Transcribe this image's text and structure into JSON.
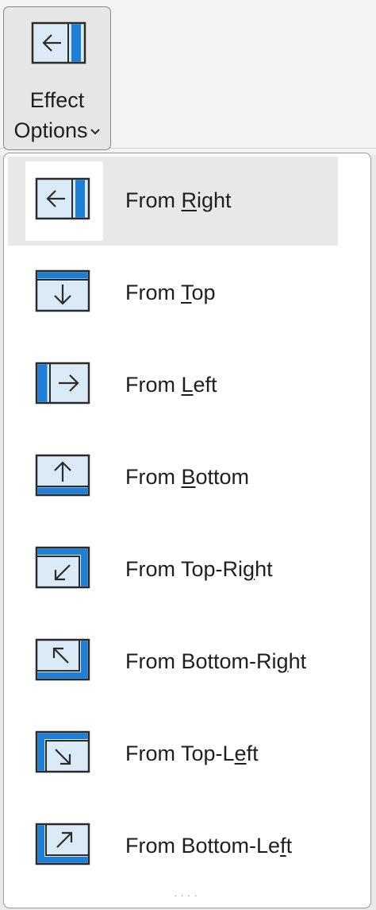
{
  "button": {
    "line1": "Effect",
    "line2": "Options",
    "icon": "from-right-icon"
  },
  "menu": {
    "items": [
      {
        "pre": "From ",
        "key": "R",
        "post": "ight",
        "icon": "from-right-icon",
        "selected": true
      },
      {
        "pre": "From ",
        "key": "T",
        "post": "op",
        "icon": "from-top-icon",
        "selected": false
      },
      {
        "pre": "From ",
        "key": "L",
        "post": "eft",
        "icon": "from-left-icon",
        "selected": false
      },
      {
        "pre": "From ",
        "key": "B",
        "post": "ottom",
        "icon": "from-bottom-icon",
        "selected": false
      },
      {
        "pre": "From Top-Ri",
        "key": "g",
        "post": "ht",
        "icon": "from-top-right-icon",
        "selected": false
      },
      {
        "pre": "From Bottom-Ri",
        "key": "g",
        "post": "ht",
        "icon": "from-bottom-right-icon",
        "selected": false
      },
      {
        "pre": "From Top-L",
        "key": "e",
        "post": "ft",
        "icon": "from-top-left-icon",
        "selected": false
      },
      {
        "pre": "From Bottom-Le",
        "key": "f",
        "post": "t",
        "icon": "from-bottom-left-icon",
        "selected": false
      }
    ]
  },
  "colors": {
    "accent": "#1e7fd6",
    "icon_fill": "#dbeaf7",
    "icon_stroke": "#2b2b2b"
  }
}
